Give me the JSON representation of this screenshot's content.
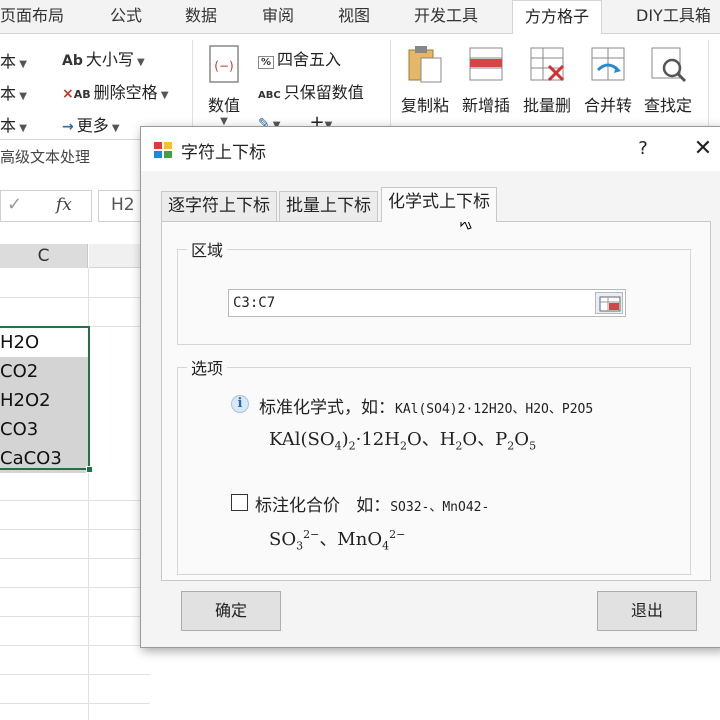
{
  "ribbon_tabs": [
    "页面布局",
    "公式",
    "数据",
    "审阅",
    "视图",
    "开发工具",
    "方方格子",
    "DIY工具箱"
  ],
  "ribbon": {
    "left_labels": [
      "本",
      "本",
      "本"
    ],
    "case_label": "大小写",
    "remove_spaces_label": "删除空格",
    "more_label": "更多",
    "number_label": "数值",
    "round_label": "四舍五入",
    "keep_value_label": "只保留数值",
    "buttons": [
      "复制粘贴",
      "新增插入",
      "批量删除",
      "合并转换",
      "查找定位"
    ],
    "buttons_visible": [
      "复制粘",
      "新增插",
      "批量删",
      "合并转",
      "查找定"
    ],
    "group_label": "高级文本处理"
  },
  "formula_bar": {
    "cancel_glyph": "✓",
    "fx": "fx",
    "content": "H2"
  },
  "sheet": {
    "column": "C",
    "cells": [
      "H2O",
      "CO2",
      "H2O2",
      "CO3",
      "CaCO3"
    ]
  },
  "dialog": {
    "title": "字符上下标",
    "help": "?",
    "close": "✕",
    "tabs": [
      "逐字符上下标",
      "批量上下标",
      "化学式上下标"
    ],
    "active_tab": 2,
    "range_group": "区域",
    "range_value": "C3:C7",
    "options_group": "选项",
    "option1_label": "标准化学式，如：",
    "option1_example": "KAl(SO4)2·12H2O、H2O、P2O5",
    "option2_label": "标注化合价",
    "option2_prefix": "如：",
    "option2_example": "SO32-、MnO42-",
    "option2_checked": false,
    "ok": "确定",
    "exit": "退出"
  },
  "colors": {
    "accent_green": "#217346",
    "selection_gray": "#d4d4d4",
    "dialog_bg": "#f4f4f4"
  }
}
